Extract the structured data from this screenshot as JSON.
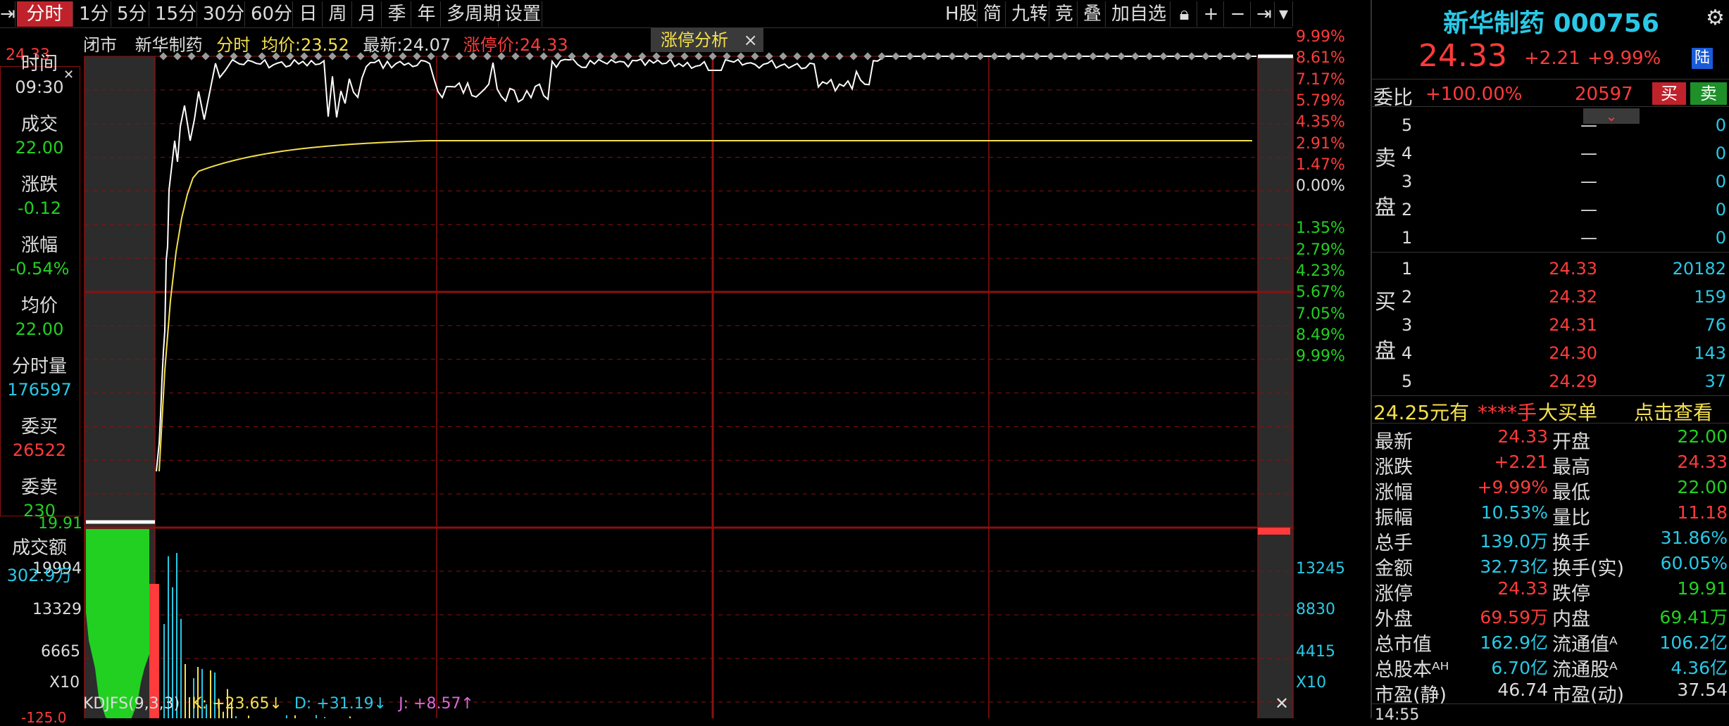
{
  "toolbar": {
    "items": [
      "分时",
      "1分",
      "5分",
      "15分",
      "30分",
      "60分",
      "日",
      "周",
      "月",
      "季",
      "年",
      "多周期",
      "设置"
    ],
    "right_items": [
      "H股",
      "简",
      "九转",
      "竞",
      "叠",
      "加自选"
    ]
  },
  "chart": {
    "status": "闭市",
    "name": "新华制药",
    "mode": "分时",
    "avg_label": "均价:23.52",
    "latest_label": "最新:24.07",
    "limit_label": "涨停价:24.33",
    "analysis_btn": "涨停分析",
    "left_top_price": "24.33",
    "right_pct_upper": [
      "9.99%",
      "8.61%",
      "7.17%",
      "5.79%",
      "4.35%",
      "2.91%",
      "1.47%",
      "0.00%"
    ],
    "right_pct_lower": [
      "1.35%",
      "2.79%",
      "4.23%",
      "5.67%",
      "7.05%",
      "8.49%",
      "9.99%"
    ],
    "vol_left": [
      "19.91",
      "19994",
      "13329",
      "6665",
      "X10"
    ],
    "vol_right": [
      "13245",
      "8830",
      "4415",
      "X10"
    ],
    "indicator": {
      "name": "KDJFS(9,3,3)",
      "k": "K: +23.65↓",
      "d": "D: +31.19↓",
      "j": "J: +8.57↑"
    },
    "bottom_left": "-125.0"
  },
  "info_panel": [
    {
      "label": "时间",
      "value": "09:30",
      "color": "#dddddd"
    },
    {
      "label": "成交",
      "value": "22.00",
      "color": "#22d022"
    },
    {
      "label": "涨跌",
      "value": "-0.12",
      "color": "#22d022"
    },
    {
      "label": "涨幅",
      "value": "-0.54%",
      "color": "#22d022"
    },
    {
      "label": "均价",
      "value": "22.00",
      "color": "#22d022"
    },
    {
      "label": "分时量",
      "value": "176597",
      "color": "#29c9e6"
    },
    {
      "label": "委买",
      "value": "26522",
      "color": "#ff3b3b"
    },
    {
      "label": "委卖",
      "value": "230",
      "color": "#22d022"
    },
    {
      "label": "成交额",
      "value": "302.9万",
      "color": "#29c9e6"
    }
  ],
  "stock": {
    "name_code": "新华制药 000756",
    "price": "24.33",
    "change": "+2.21",
    "pct": "+9.99%",
    "exchange_badge": "陆",
    "weibi_label": "委比",
    "weibi_value": "+100.00%",
    "weicha": "20597",
    "buy_btn": "买",
    "sell_btn": "卖"
  },
  "orderbook": {
    "sell_side_label": [
      "卖",
      "盘"
    ],
    "buy_side_label": [
      "买",
      "盘"
    ],
    "sells": [
      {
        "level": "5",
        "price": "—",
        "vol": "0"
      },
      {
        "level": "4",
        "price": "—",
        "vol": "0"
      },
      {
        "level": "3",
        "price": "—",
        "vol": "0"
      },
      {
        "level": "2",
        "price": "—",
        "vol": "0"
      },
      {
        "level": "1",
        "price": "—",
        "vol": "0"
      }
    ],
    "buys": [
      {
        "level": "1",
        "price": "24.33",
        "vol": "20182"
      },
      {
        "level": "2",
        "price": "24.32",
        "vol": "159"
      },
      {
        "level": "3",
        "price": "24.31",
        "vol": "76"
      },
      {
        "level": "4",
        "price": "24.30",
        "vol": "143"
      },
      {
        "level": "5",
        "price": "24.29",
        "vol": "37"
      }
    ]
  },
  "bigorder": {
    "text": "24.25元有",
    "hand": "****手",
    "big": "大买单",
    "link": "点击查看"
  },
  "stats": [
    [
      "最新",
      "24.33",
      "red",
      "开盘",
      "22.00",
      "green"
    ],
    [
      "涨跌",
      "+2.21",
      "red",
      "最高",
      "24.33",
      "red"
    ],
    [
      "涨幅",
      "+9.99%",
      "red",
      "最低",
      "22.00",
      "green"
    ],
    [
      "振幅",
      "10.53%",
      "cyan",
      "量比",
      "11.18",
      "red"
    ],
    [
      "总手",
      "139.0万",
      "cyan",
      "换手",
      "31.86%",
      "cyan"
    ],
    [
      "金额",
      "32.73亿",
      "cyan",
      "换手(实)",
      "60.05%",
      "cyan"
    ],
    [
      "涨停",
      "24.33",
      "red",
      "跌停",
      "19.91",
      "green"
    ],
    [
      "外盘",
      "69.59万",
      "red",
      "内盘",
      "69.41万",
      "green"
    ],
    [
      "总市值",
      "162.9亿",
      "cyan",
      "流通值ᴬ",
      "106.2亿",
      "cyan"
    ],
    [
      "总股本ᴬᴴ",
      "6.70亿",
      "cyan",
      "流通股ᴬ",
      "4.36亿",
      "cyan"
    ],
    [
      "市盈(静)",
      "46.74",
      "white",
      "市盈(动)",
      "37.54",
      "white"
    ]
  ],
  "bottom_time": "14:55",
  "colors": {
    "red": "#ff3b3b",
    "green": "#22d022",
    "cyan": "#29c9e6",
    "yellow": "#f4e04d",
    "grid": "#8b1010",
    "accent": "#c0222b"
  }
}
